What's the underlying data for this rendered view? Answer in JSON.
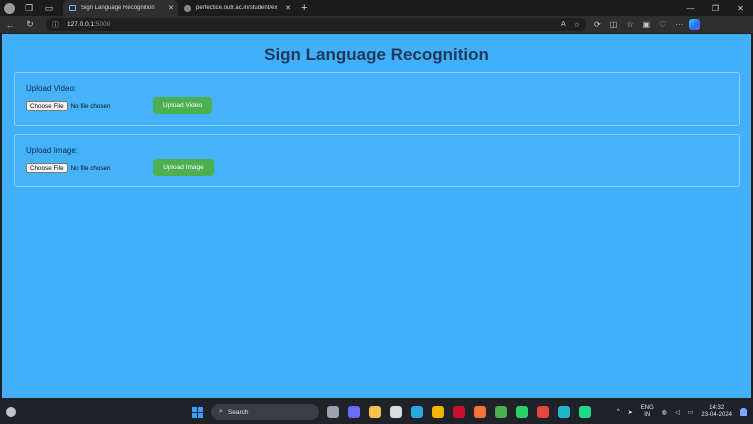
{
  "browser": {
    "tabs": [
      {
        "title": "Sign Language Recognition",
        "active": true
      },
      {
        "title": "perfectice.outr.ac.in/student/ex",
        "active": false
      }
    ],
    "address": {
      "host": "127.0.0.1:",
      "port": "5000"
    }
  },
  "page": {
    "title": "Sign Language Recognition",
    "video_section": {
      "label": "Upload Video:",
      "choose_label": "Choose File",
      "no_file_text": "No file chosen",
      "upload_label": "Upload Video"
    },
    "image_section": {
      "label": "Upload Image:",
      "choose_label": "Choose File",
      "no_file_text": "No file chosen",
      "upload_label": "Upload Image"
    }
  },
  "taskbar": {
    "search_label": "Search",
    "lang_line1": "ENG",
    "lang_line2": "IN",
    "time": "14:32",
    "date": "23-04-2024"
  },
  "colors": {
    "page_bg": "#42affa",
    "upload_button": "#4caf50",
    "title_text": "#1c3a5c"
  }
}
